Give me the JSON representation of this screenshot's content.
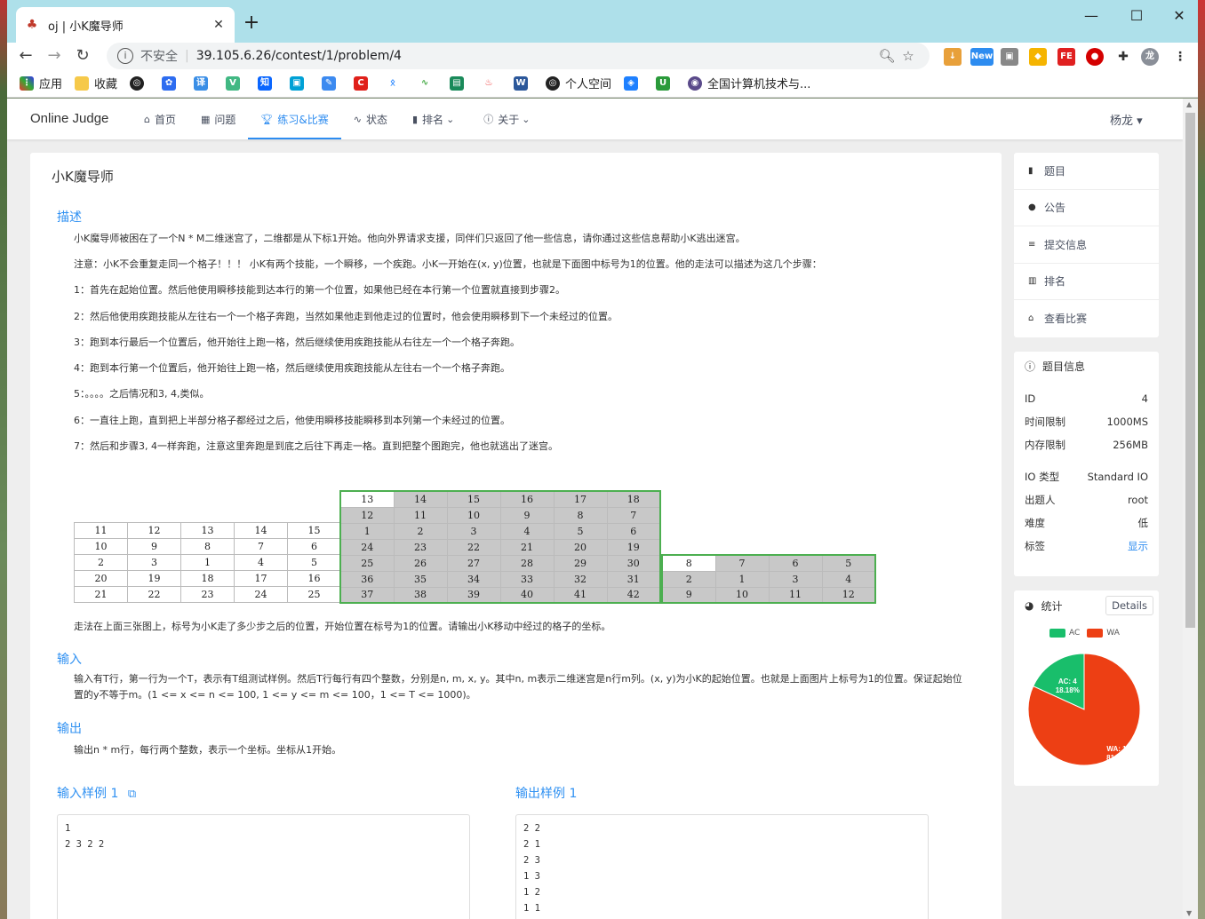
{
  "browser": {
    "tab_title": "oj | 小K魔导师",
    "tab_close": "✕",
    "new_tab": "+",
    "url": "39.105.6.26/contest/1/problem/4",
    "insecure_label": "不安全",
    "bookmarks": [
      "应用",
      "收藏",
      "个人空间",
      "全国计算机技术与..."
    ]
  },
  "header": {
    "logo": "Online Judge",
    "menu": [
      "首页",
      "问题",
      "练习&比赛",
      "状态",
      "排名",
      "关于"
    ],
    "active_index": 2,
    "user": "杨龙"
  },
  "problem": {
    "title": "小K魔导师",
    "description_title": "描述",
    "description": [
      "小K魔导师被困在了一个N * M二维迷宫了，二维都是从下标1开始。他向外界请求支援，同伴们只返回了他一些信息，请你通过这些信息帮助小K逃出迷宫。",
      "注意：小K不会重复走同一个格子！！！ 小K有两个技能，一个瞬移，一个疾跑。小K一开始在(x, y)位置，也就是下面图中标号为1的位置。他的走法可以描述为这几个步骤：",
      "1：首先在起始位置。然后他使用瞬移技能到达本行的第一个位置，如果他已经在本行第一个位置就直接到步骤2。",
      "2：然后他使用疾跑技能从左往右一个一个格子奔跑，当然如果他走到他走过的位置时，他会使用瞬移到下一个未经过的位置。",
      "3：跑到本行最后一个位置后，他开始往上跑一格，然后继续使用疾跑技能从右往左一个一个格子奔跑。",
      "4：跑到本行第一个位置后，他开始往上跑一格，然后继续使用疾跑技能从左往右一个一个格子奔跑。",
      "5：。。。。之后情况和3, 4,类似。",
      "6：一直往上跑，直到把上半部分格子都经过之后，他使用瞬移技能瞬移到本列第一个未经过的位置。",
      "7：然后和步骤3, 4一样奔跑，注意这里奔跑是到底之后往下再走一格。直到把整个图跑完，他也就逃出了迷宫。"
    ],
    "grid1": [
      [
        "11",
        "12",
        "13",
        "14",
        "15"
      ],
      [
        "10",
        "9",
        "8",
        "7",
        "6"
      ],
      [
        "2",
        "3",
        "1",
        "4",
        "5"
      ],
      [
        "20",
        "19",
        "18",
        "17",
        "16"
      ],
      [
        "21",
        "22",
        "23",
        "24",
        "25"
      ]
    ],
    "grid2": [
      [
        "13",
        "14",
        "15",
        "16",
        "17",
        "18"
      ],
      [
        "12",
        "11",
        "10",
        "9",
        "8",
        "7"
      ],
      [
        "1",
        "2",
        "3",
        "4",
        "5",
        "6"
      ],
      [
        "24",
        "23",
        "22",
        "21",
        "20",
        "19"
      ],
      [
        "25",
        "26",
        "27",
        "28",
        "29",
        "30"
      ],
      [
        "36",
        "35",
        "34",
        "33",
        "32",
        "31"
      ],
      [
        "37",
        "38",
        "39",
        "40",
        "41",
        "42"
      ]
    ],
    "grid3": [
      [
        "8",
        "7",
        "6",
        "5"
      ],
      [
        "2",
        "1",
        "3",
        "4"
      ],
      [
        "9",
        "10",
        "11",
        "12"
      ]
    ],
    "after_grid": "走法在上面三张图上，标号为小K走了多少步之后的位置，开始位置在标号为1的位置。请输出小K移动中经过的格子的坐标。",
    "input_title": "输入",
    "input_text": "输入有T行，第一行为一个T，表示有T组测试样例。然后T行每行有四个整数，分别是n, m, x, y。其中n, m表示二维迷宫是n行m列。(x, y)为小K的起始位置。也就是上面图片上标号为1的位置。保证起始位置的y不等于m。(1 <= x <= n <= 100, 1 <= y <= m <= 100，1 <= T <= 1000)。",
    "output_title": "输出",
    "output_text": "输出n * m行，每行两个整数，表示一个坐标。坐标从1开始。",
    "sample_input_title": "输入样例 1",
    "sample_output_title": "输出样例 1",
    "sample_input": "1\n2 3 2 2",
    "sample_output": "2 2\n2 1\n2 3\n1 3\n1 2\n1 1"
  },
  "sidebar": {
    "nav": [
      "题目",
      "公告",
      "提交信息",
      "排名",
      "查看比赛"
    ],
    "info_title": "题目信息",
    "info": [
      {
        "k": "ID",
        "v": "4"
      },
      {
        "k": "时间限制",
        "v": "1000MS"
      },
      {
        "k": "内存限制",
        "v": "256MB"
      },
      {
        "k": "IO 类型",
        "v": "Standard IO"
      },
      {
        "k": "出题人",
        "v": "root"
      },
      {
        "k": "难度",
        "v": "低"
      },
      {
        "k": "标签",
        "v": "显示"
      }
    ],
    "stats_title": "统计",
    "details_label": "Details"
  },
  "chart_data": {
    "type": "pie",
    "categories": [
      "AC",
      "WA"
    ],
    "values": [
      4,
      18
    ],
    "percent_labels": [
      "18.18%",
      "81.82%"
    ],
    "slice_labels": [
      "AC: 4",
      "WA: 18"
    ],
    "colors": {
      "AC": "#19be6b",
      "WA": "#ed3f14"
    },
    "legend": "top"
  }
}
